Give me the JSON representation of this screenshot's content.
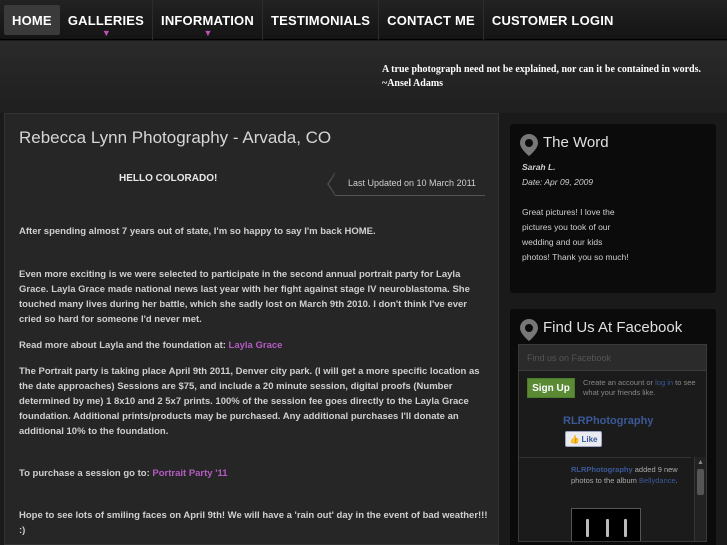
{
  "nav": {
    "items": [
      {
        "label": "HOME",
        "active": true,
        "has_dropdown": false
      },
      {
        "label": "GALLERIES",
        "active": false,
        "has_dropdown": true
      },
      {
        "label": "INFORMATION",
        "active": false,
        "has_dropdown": true
      },
      {
        "label": "TESTIMONIALS",
        "active": false,
        "has_dropdown": false
      },
      {
        "label": "CONTACT ME",
        "active": false,
        "has_dropdown": false
      },
      {
        "label": "CUSTOMER LOGIN",
        "active": false,
        "has_dropdown": false
      }
    ],
    "dropdown_caret": "▼"
  },
  "header": {
    "quote_line1": "A true photograph need not be explained, nor can it be contained in words.",
    "quote_line2": "~Ansel Adams"
  },
  "main": {
    "title": "Rebecca Lynn Photography - Arvada, CO",
    "hello": "HELLO COLORADO!",
    "last_updated": "Last Updated on 10 March 2011",
    "p1": "After spending almost 7 years out of state, I'm so happy to say I'm back HOME.",
    "p2": "Even more exciting is we were selected to participate in the second annual portrait party for Layla Grace.  Layla Grace made national news last year with her fight against stage IV neuroblastoma. She touched many lives during her battle, which she sadly lost on March 9th 2010.  I don't think I've ever cried so hard for someone I'd never met.",
    "p3_prefix": "Read more about Layla and the foundation at: ",
    "p3_link": "Layla Grace",
    "p4": "The Portrait party is taking place April 9th 2011, Denver city park. (I will get a more specific location as the date approaches)  Sessions are $75, and include a 20 minute session, digital proofs (Number determined by me) 1 8x10 and 2 5x7 prints.  100% of the session fee goes directly to the Layla Grace foundation.  Additional prints/products may be purchased.  Any additional purchases I'll donate an additional 10% to the foundation.",
    "p5_prefix": "To purchase a session go to: ",
    "p5_link": "Portrait Party '11",
    "p6": "Hope to see lots of smiling faces on April 9th!  We will have a 'rain out' day in the event of bad weather!!! :)"
  },
  "sidebar": {
    "word": {
      "title": "The Word",
      "author": "Sarah L.",
      "date": "Date: Apr 09, 2009",
      "text": "Great pictures! I love the pictures you took of our wedding and our kids photos! Thank you so much!"
    },
    "facebook": {
      "title": "Find Us At Facebook",
      "header_text": "Find us on Facebook",
      "signup_label": "Sign Up",
      "signup_text_1": "Create an account or ",
      "login_link": "log in",
      "signup_text_2": " to see what your friends like.",
      "page_name": "RLRPhotography",
      "like_label": "Like",
      "post_author": "RLRPhotography",
      "post_text": " added 9 new photos to the album ",
      "post_album": "Bellydance",
      "post_end": "."
    }
  },
  "colors": {
    "accent": "#b55bc4",
    "facebook_blue": "#3b5998",
    "signup_green": "#5b8a35"
  }
}
